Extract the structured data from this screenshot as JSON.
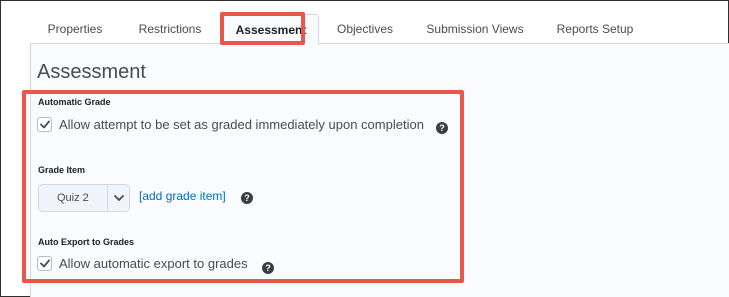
{
  "tabs": [
    {
      "label": "Properties"
    },
    {
      "label": "Restrictions"
    },
    {
      "label": "Assessment"
    },
    {
      "label": "Objectives"
    },
    {
      "label": "Submission Views"
    },
    {
      "label": "Reports Setup"
    }
  ],
  "page": {
    "title": "Assessment"
  },
  "automatic_grade": {
    "label": "Automatic Grade",
    "checkbox_text": "Allow attempt to be set as graded immediately upon completion",
    "checked": true
  },
  "grade_item": {
    "label": "Grade Item",
    "selected": "Quiz 2",
    "link": "[add grade item]"
  },
  "auto_export": {
    "label": "Auto Export to Grades",
    "checkbox_text": "Allow automatic export to grades",
    "checked": true
  },
  "help_icon": {
    "glyph": "?"
  },
  "colors": {
    "highlight": "#e8574a",
    "link": "#006fbf",
    "panel_bg": "#f9fbff"
  }
}
